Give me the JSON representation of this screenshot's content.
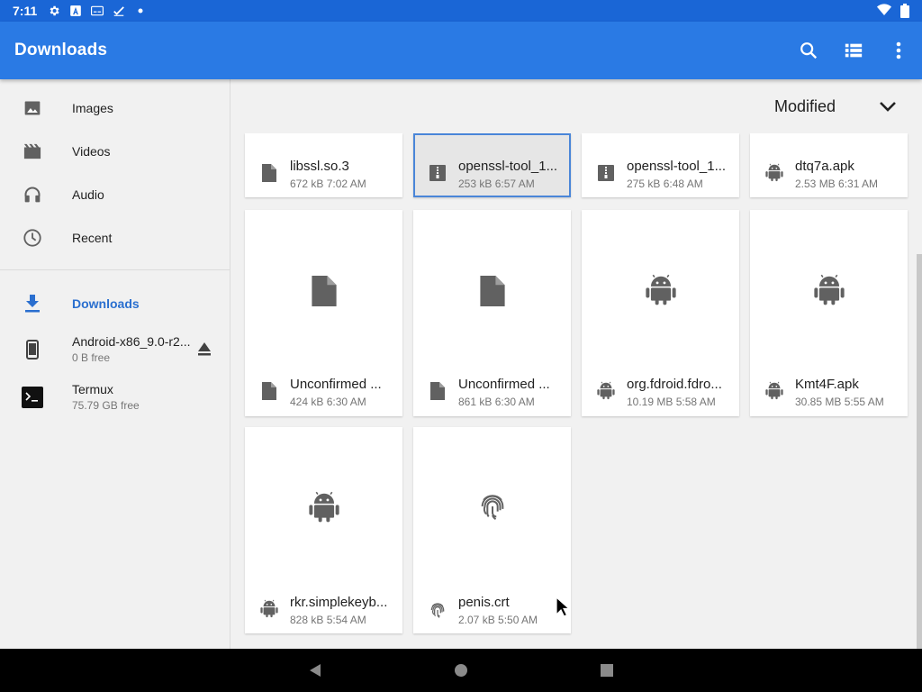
{
  "status_bar": {
    "time": "7:11"
  },
  "app_bar": {
    "title": "Downloads"
  },
  "sidebar": {
    "items": [
      {
        "label": "Images",
        "icon": "image-icon"
      },
      {
        "label": "Videos",
        "icon": "movie-icon"
      },
      {
        "label": "Audio",
        "icon": "headphones-icon"
      },
      {
        "label": "Recent",
        "icon": "clock-icon"
      }
    ],
    "roots": [
      {
        "label": "Downloads",
        "icon": "download-icon",
        "selected": true
      },
      {
        "label": "Android-x86_9.0-r2...",
        "subtitle": "0 B free",
        "icon": "phone-icon"
      },
      {
        "label": "Termux",
        "subtitle": "75.79 GB free",
        "icon": "terminal-icon"
      }
    ]
  },
  "sort": {
    "label": "Modified"
  },
  "files": [
    {
      "name": "libssl.so.3",
      "meta": "672 kB 7:02 AM",
      "icon": "file-icon"
    },
    {
      "name": "openssl-tool_1...",
      "meta": "253 kB 6:57 AM",
      "icon": "archive-icon",
      "selected": true
    },
    {
      "name": "openssl-tool_1...",
      "meta": "275 kB 6:48 AM",
      "icon": "archive-icon"
    },
    {
      "name": "dtq7a.apk",
      "meta": "2.53 MB 6:31 AM",
      "icon": "android-icon"
    },
    {
      "name": "Unconfirmed ...",
      "meta": "424 kB 6:30 AM",
      "icon": "file-icon"
    },
    {
      "name": "Unconfirmed ...",
      "meta": "861 kB 6:30 AM",
      "icon": "file-icon"
    },
    {
      "name": "org.fdroid.fdro...",
      "meta": "10.19 MB 5:58 AM",
      "icon": "android-icon"
    },
    {
      "name": "Kmt4F.apk",
      "meta": "30.85 MB 5:55 AM",
      "icon": "android-icon"
    },
    {
      "name": "rkr.simplekeyb...",
      "meta": "828 kB 5:54 AM",
      "icon": "android-icon"
    },
    {
      "name": "penis.crt",
      "meta": "2.07 kB 5:50 AM",
      "icon": "fingerprint-icon"
    }
  ],
  "colors": {
    "status_bar": "#1a66d6",
    "app_bar": "#2a7ae4",
    "accent": "#2a6fcf",
    "icon_grey": "#616161"
  }
}
